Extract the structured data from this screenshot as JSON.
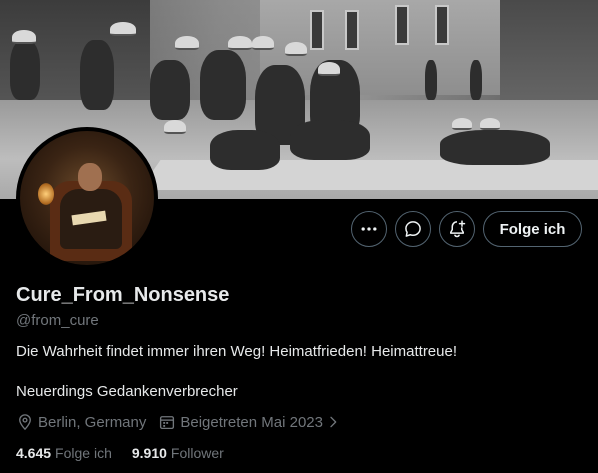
{
  "profile": {
    "display_name": "Cure_From_Nonsense",
    "handle": "@from_cure",
    "bio": "Die Wahrheit findet immer ihren Weg! Heimatfrieden! Heimattreue!",
    "bio_line2": "Neuerdings Gedankenverbrecher",
    "location": "Berlin, Germany",
    "joined": "Beigetreten Mai 2023",
    "following_count": "4.645",
    "following_label": "Folge ich",
    "followers_count": "9.910",
    "followers_label": "Follower"
  },
  "actions": {
    "more_icon": "more-dots-icon",
    "message_icon": "message-bubble-icon",
    "notify_icon": "bell-plus-icon",
    "follow_label": "Folge ich"
  },
  "colors": {
    "background": "#000000",
    "primary_text": "#e7e9ea",
    "secondary_text": "#71767b",
    "button_border": "#536471"
  }
}
